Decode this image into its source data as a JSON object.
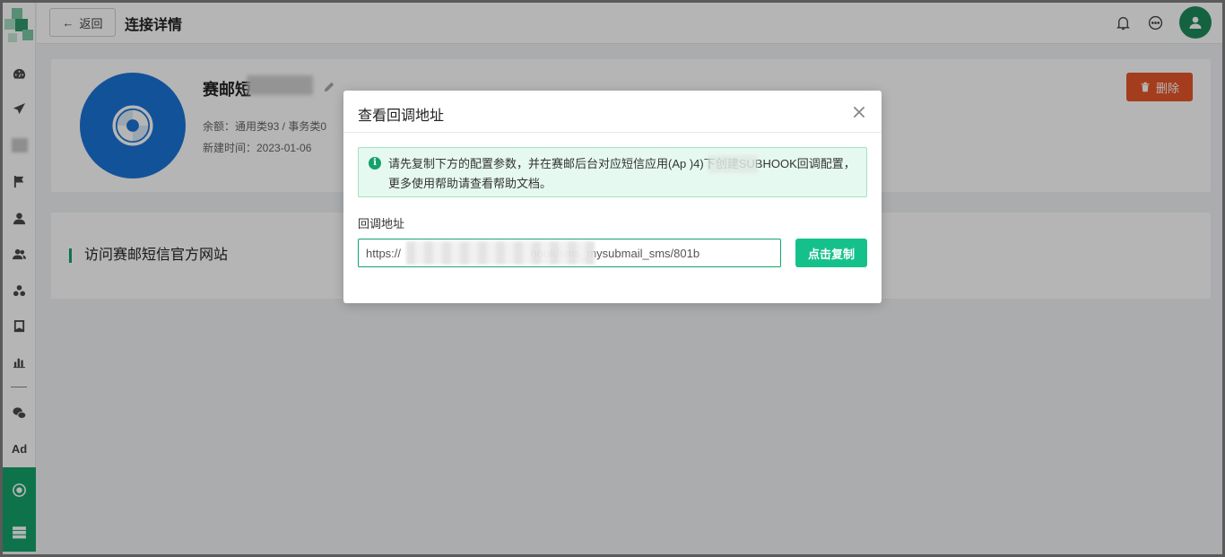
{
  "header": {
    "back_label": "返回",
    "title": "连接详情"
  },
  "sidebar": {
    "ad_label": "Ad",
    "items": [
      "dashboard-icon",
      "send-icon",
      "flag-icon",
      "user-icon",
      "users-icon",
      "groups-icon",
      "bookmark-icon",
      "chart-icon",
      "wechat-icon",
      "integration-icon",
      "server-icon"
    ]
  },
  "profile": {
    "name": "赛邮短",
    "balance": "余额：通用类93 / 事务类0",
    "created": "新建时间：2023-01-06",
    "delete_label": "删除"
  },
  "links": {
    "visit_label": "访问赛邮短信官方网站"
  },
  "modal": {
    "title": "查看回调地址",
    "alert_text": "请先复制下方的配置参数，并在赛邮后台对应短信应用(Ap          )4)下创建SUBHOOK回调配置，更多使用帮助请查看帮助文档。",
    "field_label": "回调地址",
    "url_value": "https://                                        hook/sms_mysubmail_sms/801b",
    "copy_label": "点击复制"
  },
  "colors": {
    "brand_green": "#15a26a",
    "copy_button": "#15c18a",
    "delete_button": "#e8572a",
    "logo_blue": "#1a74d8"
  }
}
